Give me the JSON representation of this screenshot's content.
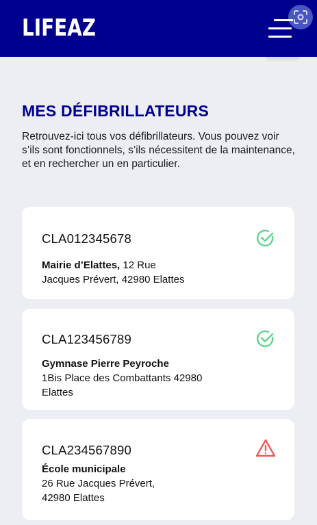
{
  "header": {
    "logo": "LIFEAZ"
  },
  "page": {
    "title": "MES DÉFIBRILLATEURS",
    "intro": "Retrouvez-ici tous vos défibrillateurs. Vous pouvez voir s’ils sont fonctionnels, s’ils nécessitent de la maintenance, et en rechercher un en particulier."
  },
  "devices": [
    {
      "code": "CLA012345678",
      "place": "Mairie d’Elattes,",
      "address_line1": " 12 Rue",
      "address_line2": "Jacques Prévert, 42980 Elattes",
      "status": "ok",
      "status_icon": "check-circle-icon",
      "status_color": "#5fd48a"
    },
    {
      "code": "CLA123456789",
      "place": "Gymnase Pierre Peyroche",
      "address_line1": "1Bis Place des Combattants 42980",
      "address_line2": "Elattes",
      "status": "ok",
      "status_icon": "check-circle-icon",
      "status_color": "#5fd48a"
    },
    {
      "code": "CLA234567890",
      "place": "École municipale",
      "address_line1": "26 Rue Jacques Prévert,",
      "address_line2": "42980 Elattes",
      "status": "warning",
      "status_icon": "warning-triangle-icon",
      "status_color": "#ee5a5a"
    }
  ],
  "colors": {
    "brand": "#00008f",
    "background": "#eceef4"
  }
}
